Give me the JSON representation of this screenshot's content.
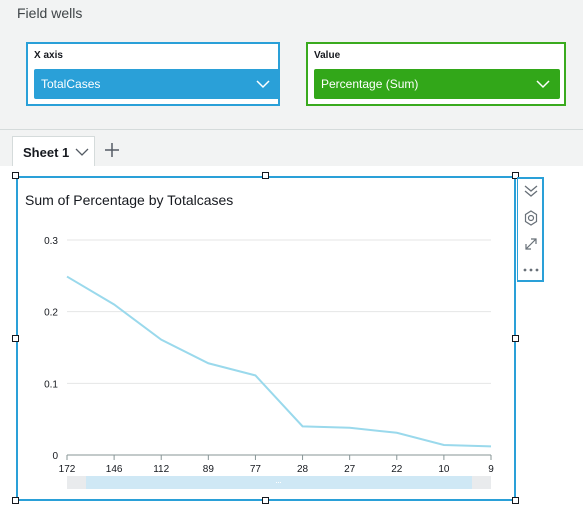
{
  "field_wells": {
    "title": "Field wells",
    "x_axis": {
      "label": "X axis",
      "field": "TotalCases"
    },
    "value": {
      "label": "Value",
      "field": "Percentage (Sum)"
    }
  },
  "sheets": {
    "tabs": [
      {
        "label": "Sheet 1"
      }
    ],
    "add_icon": "plus-icon"
  },
  "visual": {
    "title": "Sum of Percentage by Totalcases",
    "menu_icons": [
      "collapse-chevrons-icon",
      "gear-icon",
      "expand-icon",
      "more-options-icon"
    ]
  },
  "colors": {
    "xaxis_well": "#2aa0d8",
    "value_well": "#32a719",
    "selection": "#2aa0d8",
    "line": "#9ad9ec"
  },
  "chart_data": {
    "type": "line",
    "title": "Sum of Percentage by Totalcases",
    "xlabel": "",
    "ylabel": "",
    "categories": [
      "172",
      "146",
      "112",
      "89",
      "77",
      "28",
      "27",
      "22",
      "10",
      "9"
    ],
    "series": [
      {
        "values": [
          0.249,
          0.21,
          0.161,
          0.128,
          0.111,
          0.04,
          0.038,
          0.031,
          0.014,
          0.012
        ]
      }
    ],
    "ylim": [
      0,
      0.3
    ],
    "yticks": [
      "0",
      "0.1",
      "0.2",
      "0.3"
    ],
    "grid": true,
    "legend": "none"
  }
}
